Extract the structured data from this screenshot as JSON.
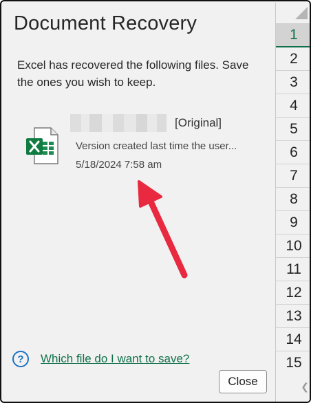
{
  "pane": {
    "title": "Document Recovery",
    "message": "Excel has recovered the following files.  Save the ones you wish to keep.",
    "file": {
      "icon": "excel-file-icon",
      "status": "[Original]",
      "description": "Version created last time the user...",
      "date": "5/18/2024 7:58 am"
    },
    "help": {
      "icon": "help-circle-icon",
      "link_text": "Which file do I want to save?"
    },
    "close_label": "Close"
  },
  "row_headers": [
    "1",
    "2",
    "3",
    "4",
    "5",
    "6",
    "7",
    "8",
    "9",
    "10",
    "11",
    "12",
    "13",
    "14",
    "15"
  ],
  "colors": {
    "excel_green": "#11704a",
    "annotation_arrow": "#e8293f",
    "help_blue": "#1c72c4"
  }
}
